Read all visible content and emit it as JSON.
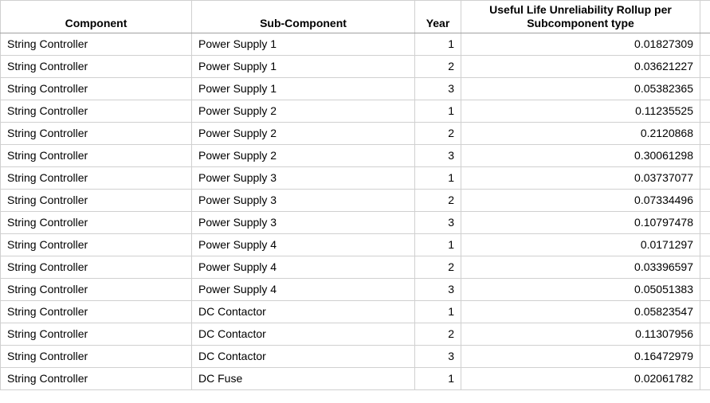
{
  "headers": {
    "component": "Component",
    "subcomponent": "Sub-Component",
    "year": "Year",
    "value": "Useful Life Unreliability Rollup per Subcomponent type"
  },
  "rows": [
    {
      "component": "String Controller",
      "subcomponent": "Power Supply 1",
      "year": "1",
      "value": "0.01827309"
    },
    {
      "component": "String Controller",
      "subcomponent": "Power Supply 1",
      "year": "2",
      "value": "0.03621227"
    },
    {
      "component": "String Controller",
      "subcomponent": "Power Supply 1",
      "year": "3",
      "value": "0.05382365"
    },
    {
      "component": "String Controller",
      "subcomponent": "Power Supply 2",
      "year": "1",
      "value": "0.11235525"
    },
    {
      "component": "String Controller",
      "subcomponent": "Power Supply 2",
      "year": "2",
      "value": "0.2120868"
    },
    {
      "component": "String Controller",
      "subcomponent": "Power Supply 2",
      "year": "3",
      "value": "0.30061298"
    },
    {
      "component": "String Controller",
      "subcomponent": "Power Supply 3",
      "year": "1",
      "value": "0.03737077"
    },
    {
      "component": "String Controller",
      "subcomponent": "Power Supply 3",
      "year": "2",
      "value": "0.07334496"
    },
    {
      "component": "String Controller",
      "subcomponent": "Power Supply 3",
      "year": "3",
      "value": "0.10797478"
    },
    {
      "component": "String Controller",
      "subcomponent": "Power Supply 4",
      "year": "1",
      "value": "0.0171297"
    },
    {
      "component": "String Controller",
      "subcomponent": "Power Supply 4",
      "year": "2",
      "value": "0.03396597"
    },
    {
      "component": "String Controller",
      "subcomponent": "Power Supply 4",
      "year": "3",
      "value": "0.05051383"
    },
    {
      "component": "String Controller",
      "subcomponent": "DC Contactor",
      "year": "1",
      "value": "0.05823547"
    },
    {
      "component": "String Controller",
      "subcomponent": "DC Contactor",
      "year": "2",
      "value": "0.11307956"
    },
    {
      "component": "String Controller",
      "subcomponent": "DC Contactor",
      "year": "3",
      "value": "0.16472979"
    },
    {
      "component": "String Controller",
      "subcomponent": "DC Fuse",
      "year": "1",
      "value": "0.02061782"
    }
  ]
}
